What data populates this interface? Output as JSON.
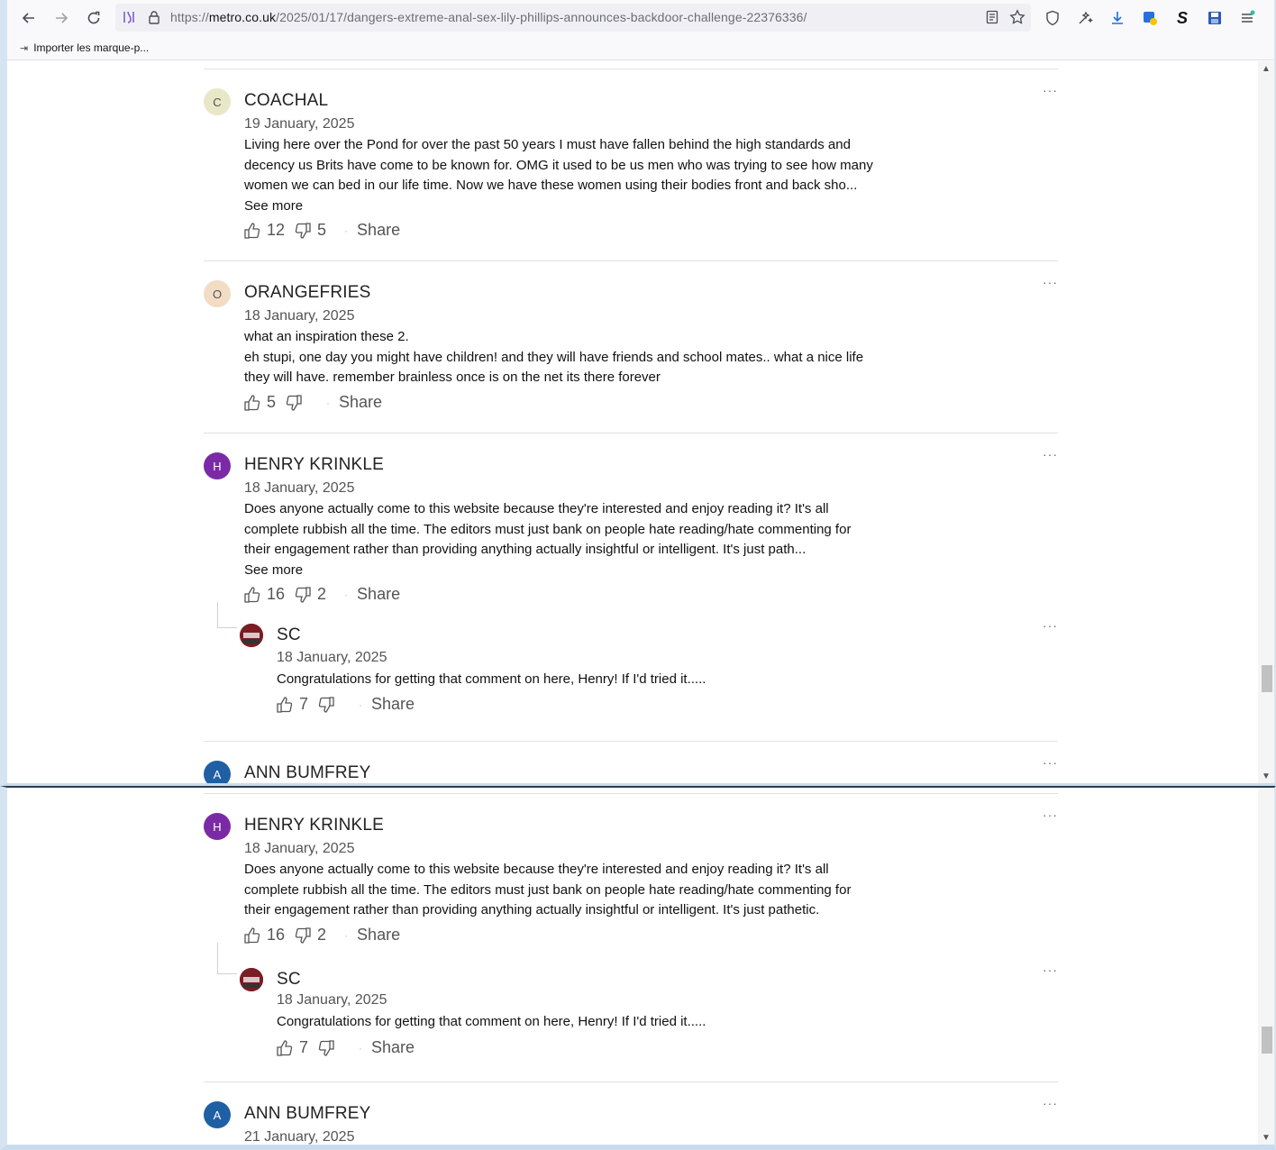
{
  "browser": {
    "url_host": "metro.co.uk",
    "url_prefix": "https://",
    "url_path": "/2025/01/17/dangers-extreme-anal-sex-lily-phillips-announces-backdoor-challenge-22376336/",
    "bookmark_label": "Importer les marque-p..."
  },
  "win1": {
    "comments": [
      {
        "initial": "C",
        "author": "COACHAL",
        "date": "19 January, 2025",
        "lines": [
          "Living here over the Pond for over the past 50 years I must have fallen behind the high standards and",
          "decency us Brits have come to be known for. OMG it used to be us  men who was trying to see how many",
          "women we can bed in our life time. Now we have these women using their bodies front and back sho..."
        ],
        "see_more": "See more",
        "likes": "12",
        "dislikes": "5",
        "share": "Share",
        "more": "···"
      },
      {
        "initial": "O",
        "author": "ORANGEFRIES",
        "date": "18 January, 2025",
        "lines": [
          "what an inspiration these 2.",
          "eh stupi, one day you might have children! and they will have friends and school mates.. what a nice life",
          "they will have. remember brainless once is on the net its there forever"
        ],
        "likes": "5",
        "dislikes": "",
        "share": "Share",
        "more": "···"
      },
      {
        "initial": "H",
        "author": "HENRY KRINKLE",
        "date": "18 January, 2025",
        "lines": [
          "Does anyone actually come to this website because they're interested and enjoy reading it? It's all",
          "complete rubbish all the time. The editors must just bank on people hate reading/hate commenting for",
          "their engagement rather than providing anything actually insightful or intelligent. It's just path..."
        ],
        "see_more": "See more",
        "likes": "16",
        "dislikes": "2",
        "share": "Share",
        "more": "···"
      },
      {
        "author": "SC",
        "date": "18 January, 2025",
        "lines": [
          "Congratulations for getting that comment on here, Henry! If I'd tried it....."
        ],
        "likes": "7",
        "dislikes": "",
        "share": "Share",
        "more": "···"
      },
      {
        "initial": "A",
        "author": "ANN BUMFREY",
        "more": "···"
      }
    ]
  },
  "win2": {
    "comments": [
      {
        "initial": "H",
        "author": "HENRY KRINKLE",
        "date": "18 January, 2025",
        "lines": [
          "Does anyone actually come to this website because they're interested and enjoy reading it? It's all",
          "complete rubbish all the time. The editors must just bank on people hate reading/hate commenting for",
          "their engagement rather than providing anything actually insightful or intelligent. It's just pathetic."
        ],
        "likes": "16",
        "dislikes": "2",
        "share": "Share",
        "more": "···"
      },
      {
        "author": "SC",
        "date": "18 January, 2025",
        "lines": [
          "Congratulations for getting that comment on here, Henry! If I'd tried it....."
        ],
        "likes": "7",
        "dislikes": "",
        "share": "Share",
        "more": "···"
      },
      {
        "initial": "A",
        "author": "ANN BUMFREY",
        "date": "21 January, 2025",
        "more": "···"
      }
    ]
  },
  "colors": {
    "avatar_c": "#e8e8c8",
    "avatar_o": "#f2dcc4",
    "avatar_h": "#7b2aa6",
    "avatar_a": "#1f5fa3",
    "avatar_sc": "#7a1d24"
  },
  "icons": [
    "back-arrow-icon",
    "forward-arrow-icon",
    "reload-icon",
    "tracking-icon",
    "lock-icon",
    "reader-view-icon",
    "bookmark-star-icon",
    "shield-icon",
    "extension-icon",
    "download-icon",
    "vpn-icon",
    "s-extension-icon",
    "save-icon",
    "menu-icon"
  ]
}
